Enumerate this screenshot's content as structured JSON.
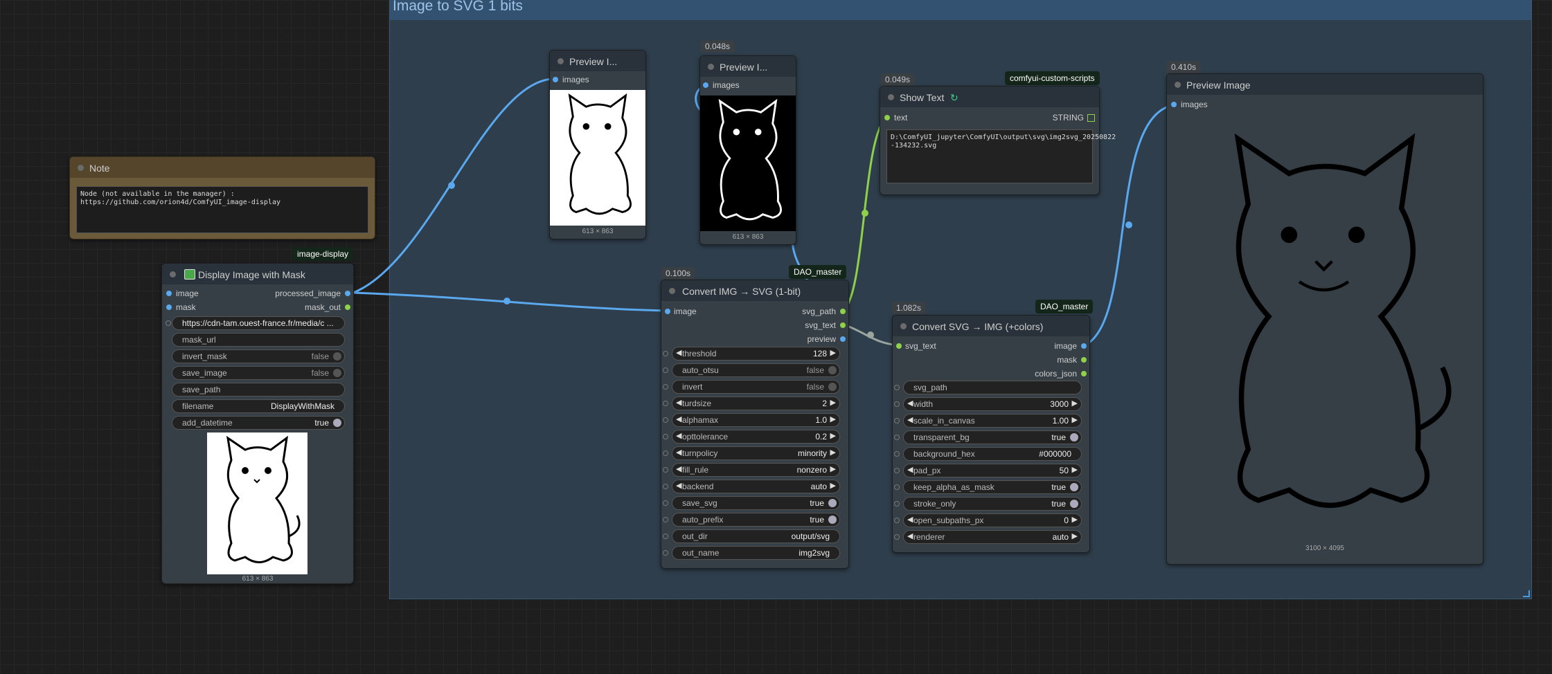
{
  "group": {
    "title": "Image to SVG 1 bits"
  },
  "note": {
    "title": "Note",
    "text": "Node (not available in the manager) :\nhttps://github.com/orion4d/ComfyUI_image-display"
  },
  "display": {
    "tag": "image-display",
    "title": "Display Image with Mask",
    "icon": "image-icon",
    "inputs": [
      "image",
      "mask"
    ],
    "outputs": [
      "processed_image",
      "mask_out"
    ],
    "url_value": "https://cdn-tam.ouest-france.fr/media/c ...",
    "w_mask_url": "mask_url",
    "w_invert_mask": "invert_mask",
    "v_invert_mask": "false",
    "w_save_image": "save_image",
    "v_save_image": "false",
    "w_save_path": "save_path",
    "w_filename": "filename",
    "v_filename": "DisplayWithMask",
    "w_add_datetime": "add_datetime",
    "v_add_datetime": "true",
    "caption": "613 × 863"
  },
  "preview1": {
    "title": "Preview I...",
    "input": "images",
    "caption": "613 × 863"
  },
  "preview2": {
    "time": "0.048s",
    "title": "Preview I...",
    "input": "images",
    "caption": "613 × 863"
  },
  "showtext": {
    "time": "0.049s",
    "tag": "comfyui-custom-scripts",
    "title": "Show Text",
    "input": "text",
    "output": "STRING",
    "value": "D:\\ComfyUI_jupyter\\ComfyUI\\output\\svg\\img2svg_20250822\n-134232.svg"
  },
  "convert1": {
    "time": "0.100s",
    "tag": "DAO_master",
    "title": "Convert IMG → SVG (1-bit)",
    "input": "image",
    "outputs": [
      "svg_path",
      "svg_text",
      "preview"
    ],
    "widgets": [
      {
        "label": "threshold",
        "value": "128",
        "kind": "num"
      },
      {
        "label": "auto_otsu",
        "value": "false",
        "kind": "bool"
      },
      {
        "label": "invert",
        "value": "false",
        "kind": "bool"
      },
      {
        "label": "turdsize",
        "value": "2",
        "kind": "num"
      },
      {
        "label": "alphamax",
        "value": "1.0",
        "kind": "num"
      },
      {
        "label": "opttolerance",
        "value": "0.2",
        "kind": "num"
      },
      {
        "label": "turnpolicy",
        "value": "minority",
        "kind": "num"
      },
      {
        "label": "fill_rule",
        "value": "nonzero",
        "kind": "num"
      },
      {
        "label": "backend",
        "value": "auto",
        "kind": "num"
      },
      {
        "label": "save_svg",
        "value": "true",
        "kind": "bool"
      },
      {
        "label": "auto_prefix",
        "value": "true",
        "kind": "bool"
      },
      {
        "label": "out_dir",
        "value": "output/svg",
        "kind": "text"
      },
      {
        "label": "out_name",
        "value": "img2svg",
        "kind": "text"
      }
    ]
  },
  "convert2": {
    "time": "1.082s",
    "tag": "DAO_master",
    "title": "Convert SVG → IMG (+colors)",
    "input": "svg_text",
    "outputs": [
      "image",
      "mask",
      "colors_json"
    ],
    "widgets": [
      {
        "label": "svg_path",
        "value": "",
        "kind": "text"
      },
      {
        "label": "width",
        "value": "3000",
        "kind": "num"
      },
      {
        "label": "scale_in_canvas",
        "value": "1.00",
        "kind": "num"
      },
      {
        "label": "transparent_bg",
        "value": "true",
        "kind": "bool"
      },
      {
        "label": "background_hex",
        "value": "#000000",
        "kind": "text"
      },
      {
        "label": "pad_px",
        "value": "50",
        "kind": "num"
      },
      {
        "label": "keep_alpha_as_mask",
        "value": "true",
        "kind": "bool"
      },
      {
        "label": "stroke_only",
        "value": "true",
        "kind": "bool"
      },
      {
        "label": "open_subpaths_px",
        "value": "0",
        "kind": "num"
      },
      {
        "label": "renderer",
        "value": "auto",
        "kind": "num"
      }
    ]
  },
  "preview3": {
    "time": "0.410s",
    "title": "Preview Image",
    "input": "images",
    "caption": "3100 × 4095"
  },
  "colors": {
    "link_image": "#5aa8ee",
    "link_string": "#8fd14a",
    "link_svg": "#9aa5a0"
  }
}
